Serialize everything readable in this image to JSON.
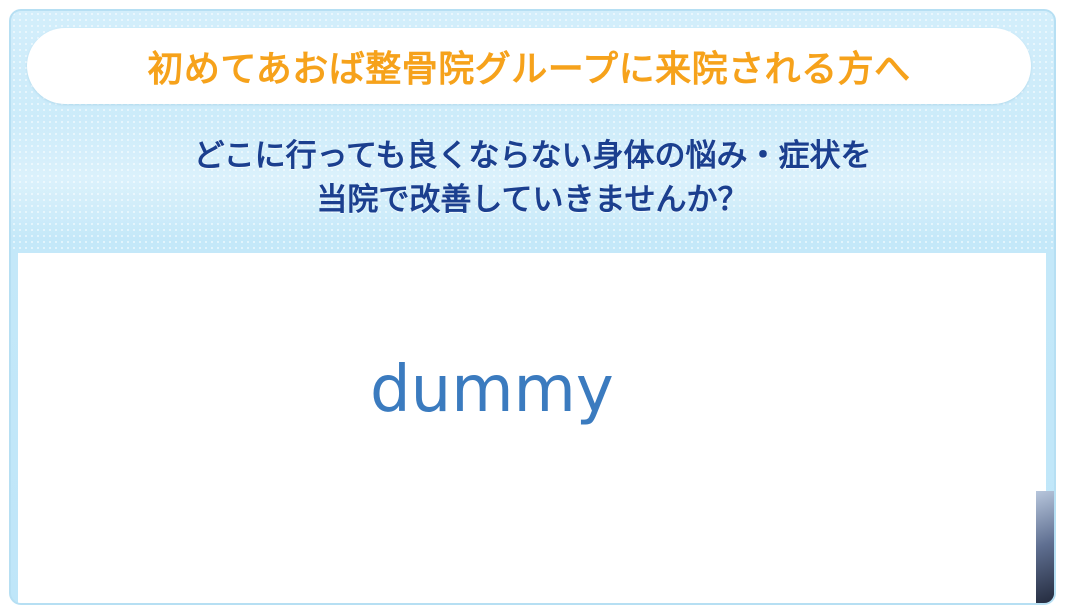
{
  "banner": {
    "title": "初めてあおば整骨院グループに来院される方へ",
    "subtitle_line1": "どこに行っても良くならない身体の悩み・症状を",
    "subtitle_line2": "当院で改善していきませんか？"
  },
  "content": {
    "placeholder_text": "dummy"
  },
  "colors": {
    "title": "#f6a21b",
    "subtitle": "#1b3f8f",
    "placeholder": "#3b7bbf",
    "background": "#c4e8f9"
  }
}
